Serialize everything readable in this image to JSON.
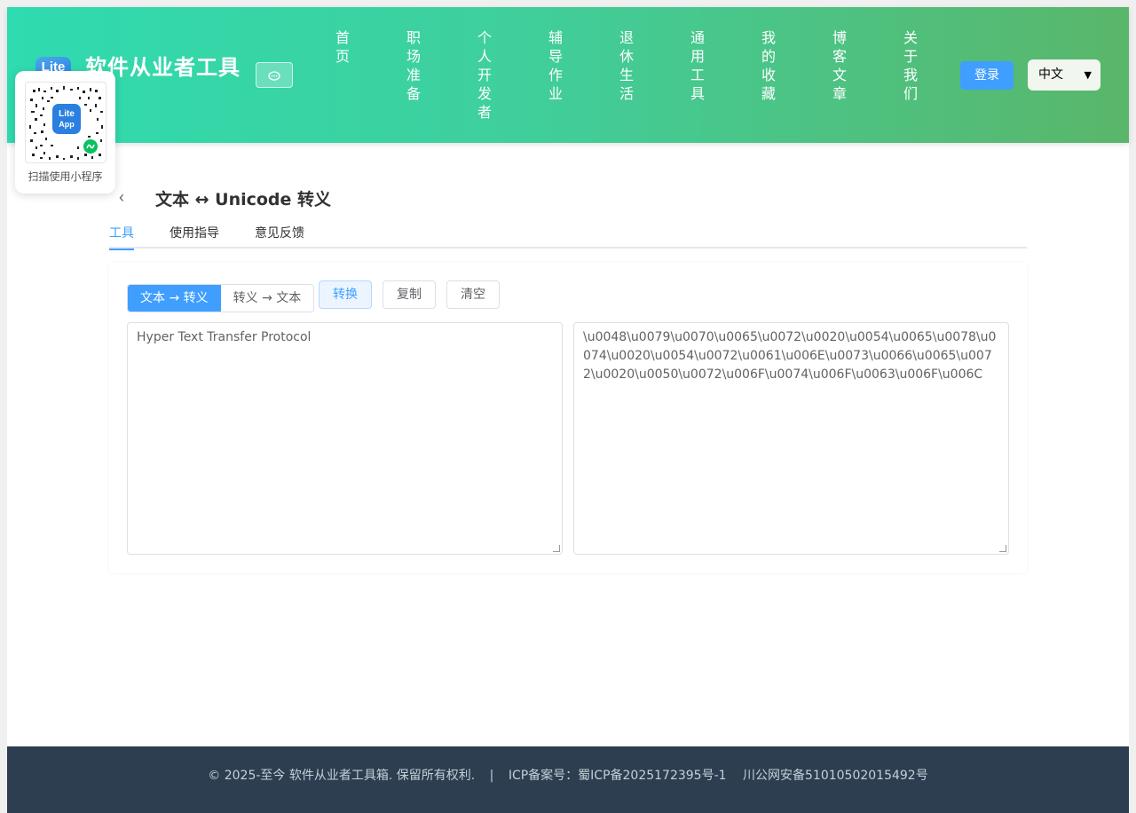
{
  "header": {
    "logo_text": "Lite",
    "site_title": "软件从业者工具",
    "chat_icon": "chat-bubble-icon",
    "nav": [
      {
        "label": "首页"
      },
      {
        "label": "职场准备"
      },
      {
        "label": "个人开发者"
      },
      {
        "label": "辅导作业"
      },
      {
        "label": "退休生活"
      },
      {
        "label": "通用工具"
      },
      {
        "label": "我的收藏"
      },
      {
        "label": "博客文章"
      },
      {
        "label": "关于我们"
      }
    ],
    "login_label": "登录",
    "language": "中文"
  },
  "qr": {
    "label": "扫描使用小程序",
    "badge_text_1": "Lite",
    "badge_text_2": "App"
  },
  "main": {
    "title": "文本 ↔ Unicode 转义",
    "tabs": [
      {
        "label": "工具",
        "active": true
      },
      {
        "label": "使用指导",
        "active": false
      },
      {
        "label": "意见反馈",
        "active": false
      }
    ],
    "modes": [
      {
        "label": "文本 → 转义",
        "active": true
      },
      {
        "label": "转义 → 文本",
        "active": false
      }
    ],
    "actions": {
      "convert": "转换",
      "copy": "复制",
      "clear": "清空"
    },
    "input_text": "Hyper Text Transfer Protocol",
    "output_text": "\\u0048\\u0079\\u0070\\u0065\\u0072\\u0020\\u0054\\u0065\\u0078\\u0074\\u0020\\u0054\\u0072\\u0061\\u006E\\u0073\\u0066\\u0065\\u0072\\u0020\\u0050\\u0072\\u006F\\u0074\\u006F\\u0063\\u006F\\u006C"
  },
  "footer": {
    "copyright": "© 2025-至今 软件从业者工具箱. 保留所有权利.",
    "separator": "|",
    "icp": "ICP备案号：蜀ICP备2025172395号-1",
    "police": "川公网安备51010502015492号"
  },
  "colors": {
    "primary": "#409eff",
    "header_gradient_start": "#2fdbb0",
    "header_gradient_end": "#5ab66a",
    "footer_bg": "#2c3e50"
  }
}
